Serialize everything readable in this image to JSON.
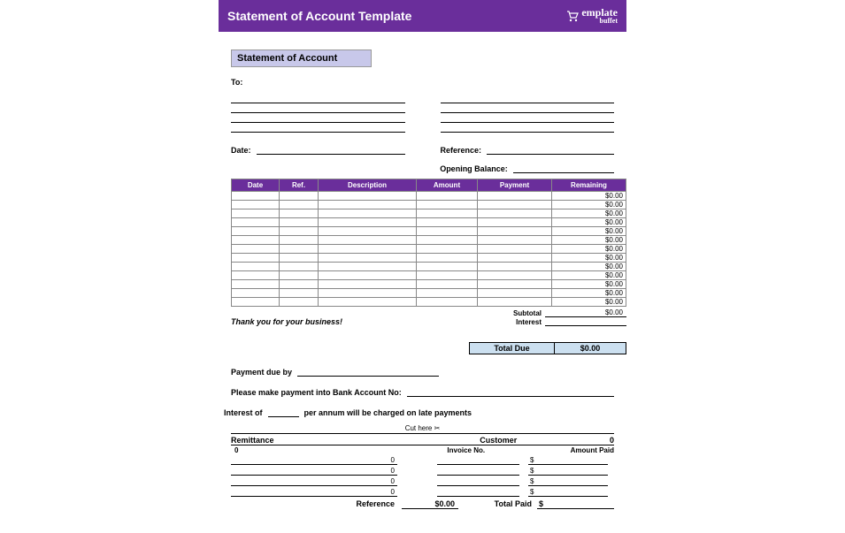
{
  "header": {
    "title": "Statement of Account Template",
    "logo_text": "emplate",
    "logo_sub": "buffet"
  },
  "doc": {
    "title": "Statement of Account",
    "to_label": "To:",
    "date_label": "Date:",
    "reference_label": "Reference:",
    "opening_balance_label": "Opening Balance:",
    "thanks": "Thank you for your business!",
    "columns": [
      "Date",
      "Ref.",
      "Description",
      "Amount",
      "Payment",
      "Remaining"
    ],
    "rows": [
      {
        "remaining": "$0.00"
      },
      {
        "remaining": "$0.00"
      },
      {
        "remaining": "$0.00"
      },
      {
        "remaining": "$0.00"
      },
      {
        "remaining": "$0.00"
      },
      {
        "remaining": "$0.00"
      },
      {
        "remaining": "$0.00"
      },
      {
        "remaining": "$0.00"
      },
      {
        "remaining": "$0.00"
      },
      {
        "remaining": "$0.00"
      },
      {
        "remaining": "$0.00"
      },
      {
        "remaining": "$0.00"
      },
      {
        "remaining": "$0.00"
      }
    ],
    "subtotal_label": "Subtotal",
    "subtotal_value": "$0.00",
    "interest_label": "Interest",
    "total_due_label": "Total Due",
    "total_due_value": "$0.00",
    "payment_due_label": "Payment due by",
    "bank_label": "Please make payment into Bank Account No:",
    "interest_of": "Interest of",
    "interest_tail": "per annum will be charged on late payments",
    "cut_label": "Cut here ✂",
    "remittance_label": "Remittance",
    "customer_label": "Customer",
    "customer_val": "0",
    "remit_zero": "0",
    "invoice_no_label": "Invoice No.",
    "amount_paid_label": "Amount Paid",
    "dollar": "$",
    "reference_foot": "Reference",
    "reference_foot_val": "$0.00",
    "total_paid_label": "Total Paid",
    "total_paid_val": "$"
  }
}
